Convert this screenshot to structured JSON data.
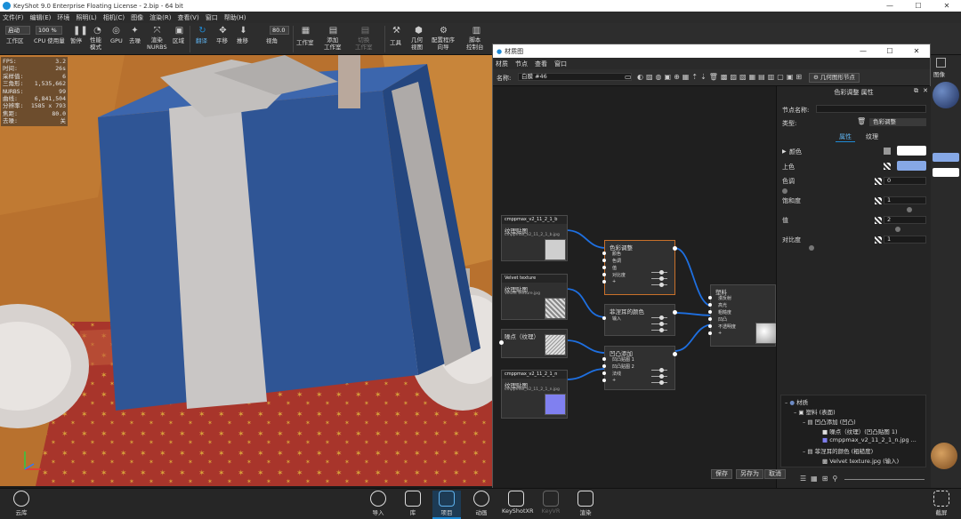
{
  "app": {
    "title": "KeyShot 9.0 Enterprise Floating License  -  2.bip  -  64 bit"
  },
  "menubar": [
    "文件(F)",
    "编辑(E)",
    "环境",
    "照明(L)",
    "相机(C)",
    "图像",
    "渲染(R)",
    "查看(V)",
    "窗口",
    "帮助(H)"
  ],
  "toolbar": {
    "mode_select": "启动",
    "zoom_value": "100 %",
    "fov_value": "80.0",
    "buttons": [
      "工作区",
      "CPU 使用量",
      "暂停",
      "性能\n模式",
      "GPU",
      "去噪",
      "渲染\nNURBS",
      "区域",
      "翻译",
      "平移",
      "推移",
      "视角",
      "工作室",
      "添加\n工作室",
      "切换\n工作室",
      "工具",
      "几何\n视图",
      "配置程序\n向导",
      "脚本\n控制台"
    ]
  },
  "stats": [
    [
      "FPS:",
      "3.2"
    ],
    [
      "时间:",
      "26s"
    ],
    [
      "采样值:",
      "6"
    ],
    [
      "三角形:",
      "1,535,662"
    ],
    [
      "NURBS:",
      "99"
    ],
    [
      "曲线:",
      "6,841,504"
    ],
    [
      "分辨率:",
      "1585 x 793"
    ],
    [
      "焦距:",
      "80.0"
    ],
    [
      "去噪:",
      "关"
    ]
  ],
  "material_window": {
    "title": "材质图",
    "menu": [
      "材质",
      "节点",
      "查看",
      "窗口"
    ],
    "name_label": "名称:",
    "name_value": "白膜 #46",
    "geometry_button": "几何图形节点",
    "nodes": {
      "n1_header": "cmppmax_v2_11_2_1_b",
      "n1_title": "纹理贴图",
      "n1_file": "cmppmax_v2_11_2_1_b.jpg",
      "n2_header": "Velvet texture",
      "n2_title": "纹理贴图",
      "n2_file": "Velvet texture.jpg",
      "n3_title": "噪点（纹理）",
      "n4_header": "cmppmax_v2_11_2_1_n",
      "n4_title": "纹理贴图",
      "n4_file": "cmppmax_v2_11_2_1_n.jpg",
      "color_adjust_title": "色彩调整",
      "color_adjust_ports": [
        "颜色",
        "色调",
        "值",
        "对比度",
        "+"
      ],
      "fresnel_title": "菲涅耳的颜色",
      "fresnel_ports": [
        "输入"
      ],
      "bump_title": "凹凸添加",
      "bump_ports": [
        "凹凸贴图 1",
        "凹凸贴图 2",
        "法线",
        "+"
      ],
      "plastic_title": "塑料",
      "plastic_ports": [
        "漫反射",
        "高光",
        "粗糙度",
        "凹凸",
        "不透明度",
        "+"
      ]
    },
    "props": {
      "header": "色彩调整 属性",
      "node_name_label": "节点名称:",
      "node_name_value": "",
      "type_label": "类型:",
      "type_value": "色彩调整",
      "tab_props": "属性",
      "tab_texture": "纹理",
      "color_label": "颜色",
      "tint_label": "上色",
      "hue_label": "色调",
      "hue_value": "0",
      "saturation_label": "饱和度",
      "saturation_value": "1",
      "value_label": "值",
      "value_value": "2",
      "contrast_label": "对比度",
      "contrast_value": "1",
      "tree": [
        "材质",
        "塑料 (表面)",
        "凹凸添加 (凹凸)",
        "噪点（纹理）(凹凸贴图 1)",
        "cmppmax_v2_11_2_1_n.jpg ...",
        "菲涅耳的颜色 (粗糙度)",
        "Velvet texture.jpg (输入)"
      ],
      "save_button": "保存",
      "save_as_button": "另存为",
      "cancel_button": "取消"
    }
  },
  "right_strip": {
    "image_label": "图像"
  },
  "bottombar": {
    "cloud": "云库",
    "items": [
      "导入",
      "库",
      "项目",
      "动画",
      "KeyShotXR",
      "KeyVR",
      "渲染"
    ],
    "screenshot": "截屏"
  },
  "colors": {
    "accent": "#1e8ad6",
    "tint_swatch": "#86a8e6",
    "node_selected_border": "#c9702a"
  }
}
